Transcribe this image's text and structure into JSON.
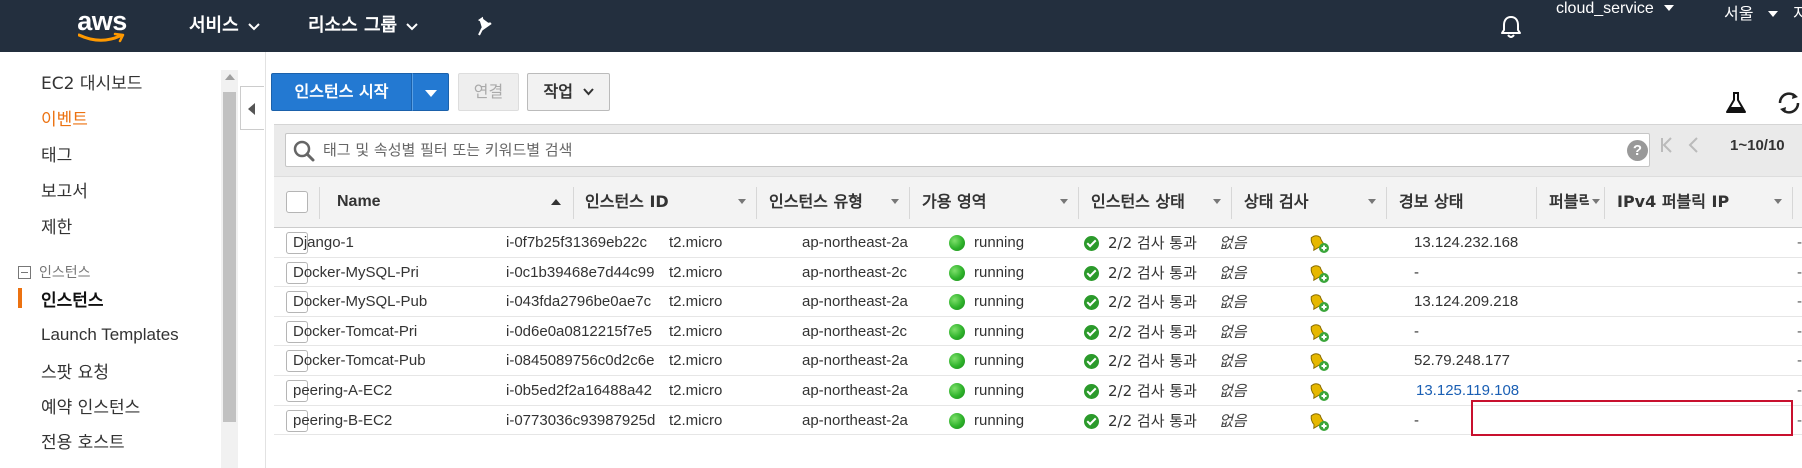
{
  "topbar": {
    "logo": "aws",
    "services": "서비스",
    "resource_groups": "리소스 그룹",
    "account": "cloud_service",
    "region": "서울",
    "overflow": "지"
  },
  "sidebar": {
    "items": [
      {
        "label": "EC2 대시보드"
      },
      {
        "label": "이벤트"
      },
      {
        "label": "태그"
      },
      {
        "label": "보고서"
      },
      {
        "label": "제한"
      }
    ],
    "section_instances": "인스턴스",
    "instances_items": [
      {
        "label": "인스턴스"
      },
      {
        "label": "Launch Templates"
      },
      {
        "label": "스팟 요청"
      },
      {
        "label": "예약 인스턴스"
      },
      {
        "label": "전용 호스트"
      }
    ]
  },
  "toolbar": {
    "launch_label": "인스턴스 시작",
    "connect_label": "연결",
    "actions_label": "작업"
  },
  "search": {
    "placeholder": "태그 및 속성별 필터 또는 키워드별 검색",
    "pagination": "1~10/10"
  },
  "table": {
    "columns": [
      "Name",
      "인스턴스 ID",
      "인스턴스 유형",
      "가용 영역",
      "인스턴스 상태",
      "상태 검사",
      "경보 상태",
      "퍼블릭",
      "IPv4 퍼블릭 IP"
    ],
    "rows": [
      {
        "name": "Django-1",
        "id": "i-0f7b25f31369eb22c",
        "type": "t2.micro",
        "az": "ap-northeast-2a",
        "state": "running",
        "check": "2/2 검사 통과",
        "alarm": "없음",
        "ip": "13.124.232.168"
      },
      {
        "name": "Docker-MySQL-Pri",
        "id": "i-0c1b39468e7d44c99",
        "type": "t2.micro",
        "az": "ap-northeast-2c",
        "state": "running",
        "check": "2/2 검사 통과",
        "alarm": "없음",
        "ip": "-"
      },
      {
        "name": "Docker-MySQL-Pub",
        "id": "i-043fda2796be0ae7c",
        "type": "t2.micro",
        "az": "ap-northeast-2a",
        "state": "running",
        "check": "2/2 검사 통과",
        "alarm": "없음",
        "ip": "13.124.209.218"
      },
      {
        "name": "Docker-Tomcat-Pri",
        "id": "i-0d6e0a0812215f7e5",
        "type": "t2.micro",
        "az": "ap-northeast-2c",
        "state": "running",
        "check": "2/2 검사 통과",
        "alarm": "없음",
        "ip": "-"
      },
      {
        "name": "Docker-Tomcat-Pub",
        "id": "i-0845089756c0d2c6e",
        "type": "t2.micro",
        "az": "ap-northeast-2a",
        "state": "running",
        "check": "2/2 검사 통과",
        "alarm": "없음",
        "ip": "52.79.248.177"
      },
      {
        "name": "peering-A-EC2",
        "id": "i-0b5ed2f2a16488a42",
        "type": "t2.micro",
        "az": "ap-northeast-2a",
        "state": "running",
        "check": "2/2 검사 통과",
        "alarm": "없음",
        "ip": "13.125.119.108"
      },
      {
        "name": "peering-B-EC2",
        "id": "i-0773036c93987925d",
        "type": "t2.micro",
        "az": "ap-northeast-2a",
        "state": "running",
        "check": "2/2 검사 통과",
        "alarm": "없음",
        "ip": "-"
      }
    ],
    "row_overflow": "-"
  },
  "colors": {
    "topbar_bg": "#232f3e",
    "primary_button": "#2379d2",
    "active_accent": "#ec7211",
    "running_green": "#2db12a",
    "highlight_red": "#c8102e"
  },
  "icons": {
    "bell": "bell-icon",
    "pin": "pin-icon",
    "flask": "flask-icon",
    "refresh": "refresh-icon",
    "search": "search-icon",
    "help": "help-icon",
    "alarm_add": "alarm-bell-add-icon"
  }
}
